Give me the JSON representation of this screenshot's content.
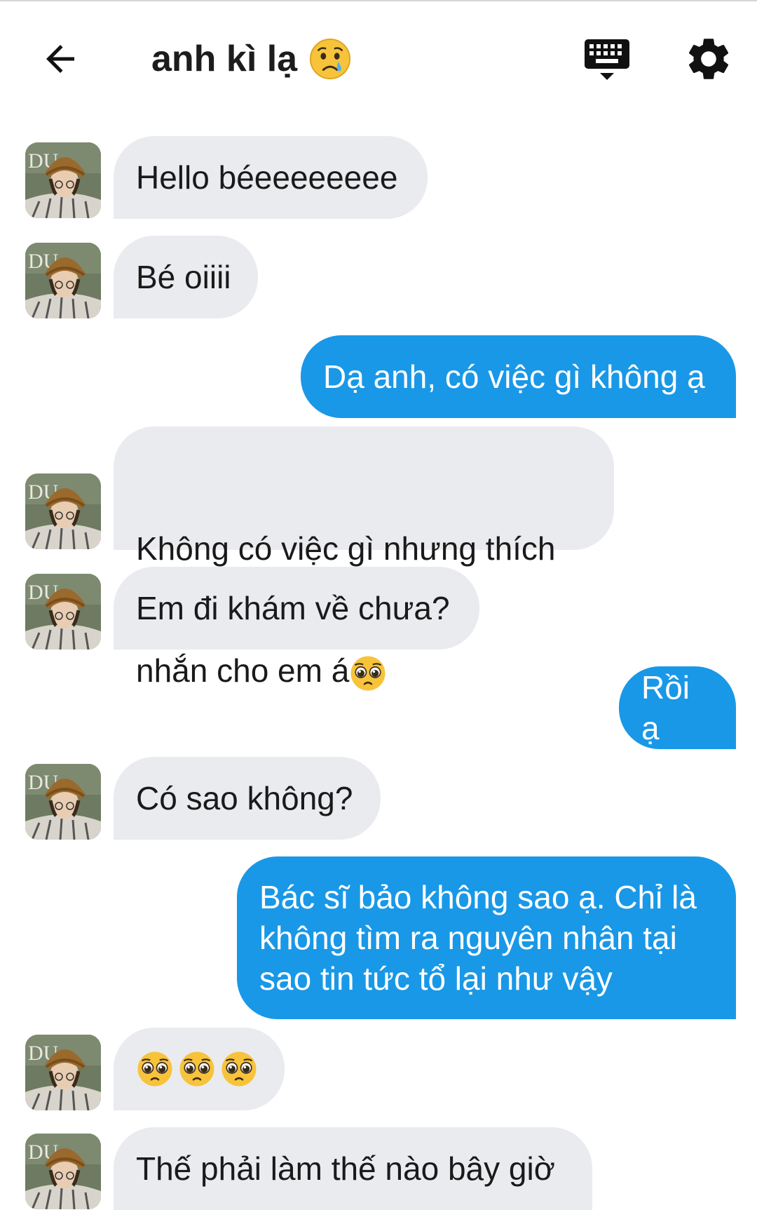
{
  "header": {
    "title": "anh kì lạ",
    "title_emoji": "crying-face",
    "back_icon": "arrow-left-icon",
    "keyboard_icon": "keyboard-icon",
    "settings_icon": "gear-icon"
  },
  "colors": {
    "incoming_bubble": "#e9ebee",
    "outgoing_bubble": "#1a98e8",
    "outgoing_text": "#ffffff",
    "incoming_text": "#1a1a1a"
  },
  "messages": [
    {
      "from": "them",
      "text": "Hello béeeeeeeee"
    },
    {
      "from": "them",
      "text": "Bé oiiii"
    },
    {
      "from": "me",
      "text": "Dạ anh, có việc gì không ạ"
    },
    {
      "from": "them",
      "line1": "Không có việc gì nhưng thích",
      "line2": "nhắn cho em á",
      "emoji": "pleading-face"
    },
    {
      "from": "them",
      "text": "Em đi khám về chưa?"
    },
    {
      "from": "me",
      "text": "Rồi ạ"
    },
    {
      "from": "them",
      "text": "Có sao không?"
    },
    {
      "from": "me",
      "text": "Bác sĩ bảo không sao ạ. Chỉ là\nkhông tìm ra nguyên nhân tại\nsao tin tức tổ lại như vậy"
    },
    {
      "from": "them",
      "emoji": "pleading-face",
      "emoji_count": 3
    },
    {
      "from": "them",
      "text": "Thế phải làm thế nào bây giờ"
    }
  ]
}
